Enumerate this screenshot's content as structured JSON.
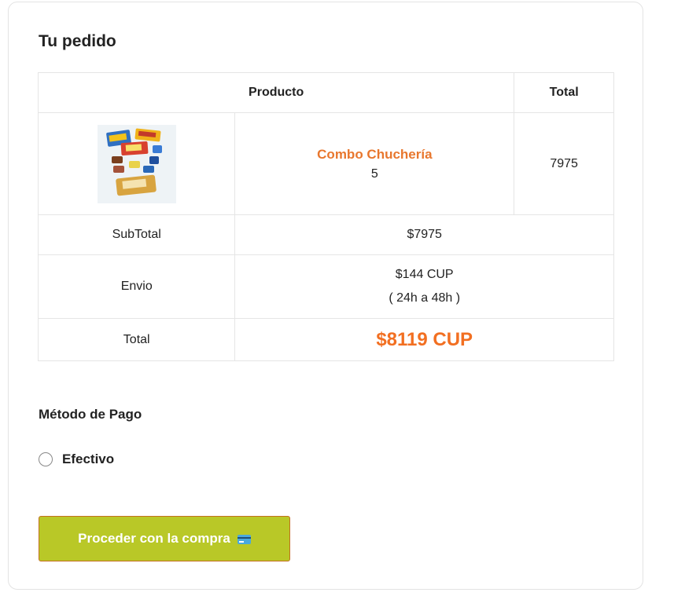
{
  "order": {
    "title": "Tu pedido",
    "headers": {
      "product": "Producto",
      "total": "Total"
    },
    "item": {
      "image_icon": "product-combo-snacks-image",
      "name": "Combo Chuchería",
      "quantity": "5",
      "total": "7975"
    },
    "subtotal": {
      "label": "SubTotal",
      "value": "$7975"
    },
    "shipping": {
      "label": "Envio",
      "value": "$144 CUP",
      "time": "( 24h a 48h )"
    },
    "total": {
      "label": "Total",
      "value": "$8119 CUP"
    }
  },
  "payment": {
    "title": "Método de Pago",
    "options": [
      {
        "label": "Efectivo",
        "selected": false
      }
    ]
  },
  "actions": {
    "proceed_label": "Proceder con la compra",
    "proceed_icon": "credit-card-icon"
  },
  "colors": {
    "accent_orange": "#e8772e",
    "button_green": "#b9c827",
    "button_border": "#c2701e"
  }
}
